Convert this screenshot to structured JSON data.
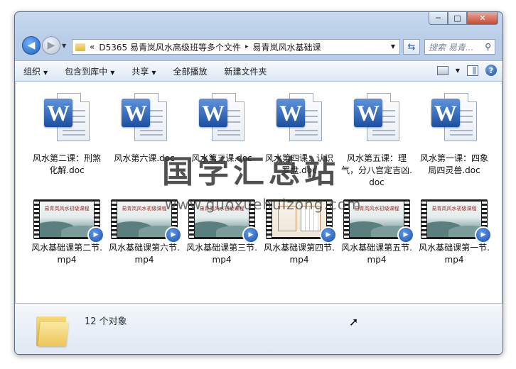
{
  "window": {
    "controls": {
      "minimize": "─",
      "maximize": "□",
      "close": "✕"
    }
  },
  "nav": {
    "back_icon": "back-arrow-icon",
    "forward_icon": "forward-arrow-icon",
    "address": {
      "prefix": "«",
      "crumbs": [
        "D5365 易青岚风水高级班等多个文件",
        "易青岚风水基础课"
      ],
      "separator": "▸"
    },
    "search_placeholder": "搜索 易青..."
  },
  "toolbar": {
    "organize": "组织",
    "include_library": "包含到库中",
    "share": "共享",
    "play_all": "全部播放",
    "new_folder": "新建文件夹"
  },
  "files": [
    {
      "name": "风水第二课：刑煞化解.doc",
      "type": "doc"
    },
    {
      "name": "风水第六课.doc",
      "type": "doc"
    },
    {
      "name": "风水第三课.doc",
      "type": "doc"
    },
    {
      "name": "风水第四课：认识罗盘.doc",
      "type": "doc"
    },
    {
      "name": "风水第五课：理气，分八宫定吉凶.doc",
      "type": "doc"
    },
    {
      "name": "风水第一课：四象局四灵兽.doc",
      "type": "doc"
    },
    {
      "name": "风水基础课第二节.mp4",
      "type": "video",
      "thumb_title": "易青岚风水初级课程"
    },
    {
      "name": "风水基础课第六节.mp4",
      "type": "video",
      "thumb_title": "易青岚风水初级课程"
    },
    {
      "name": "风水基础课第三节.mp4",
      "type": "video",
      "thumb_title": "易青岚风水初级课程"
    },
    {
      "name": "风水基础课第四节.mp4",
      "type": "video",
      "thumb_title": ""
    },
    {
      "name": "风水基础课第五节.mp4",
      "type": "video",
      "thumb_title": "易青岚风水初级课程"
    },
    {
      "name": "风水基础课第一节.mp4",
      "type": "video",
      "thumb_title": "易青岚风水初级课程"
    }
  ],
  "watermark": {
    "text": "国学汇总站",
    "url": "www.guoxuehuizong.com"
  },
  "details": {
    "count": "12 个对象"
  }
}
